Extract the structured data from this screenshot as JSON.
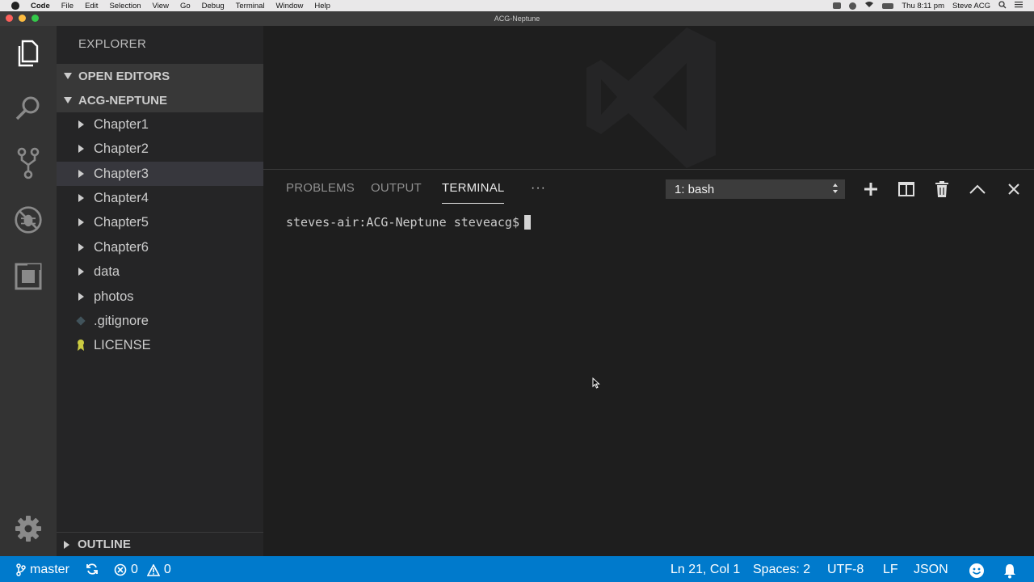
{
  "menubar": {
    "app": "Code",
    "items": [
      "File",
      "Edit",
      "Selection",
      "View",
      "Go",
      "Debug",
      "Terminal",
      "Window",
      "Help"
    ],
    "clock": "Thu 8:11 pm",
    "user": "Steve ACG"
  },
  "window": {
    "title": "ACG-Neptune"
  },
  "activity": [
    "files-icon",
    "search-icon",
    "source-control-icon",
    "debug-icon",
    "extensions-icon",
    "gear-icon"
  ],
  "sidebar": {
    "title": "EXPLORER",
    "open_editors": "OPEN EDITORS",
    "workspace": "ACG-NEPTUNE",
    "items": [
      {
        "label": "Chapter1",
        "kind": "folder"
      },
      {
        "label": "Chapter2",
        "kind": "folder"
      },
      {
        "label": "Chapter3",
        "kind": "folder",
        "selected": true
      },
      {
        "label": "Chapter4",
        "kind": "folder"
      },
      {
        "label": "Chapter5",
        "kind": "folder"
      },
      {
        "label": "Chapter6",
        "kind": "folder"
      },
      {
        "label": "data",
        "kind": "folder"
      },
      {
        "label": "photos",
        "kind": "folder"
      },
      {
        "label": ".gitignore",
        "kind": "file"
      },
      {
        "label": "LICENSE",
        "kind": "file"
      }
    ],
    "outline": "OUTLINE"
  },
  "panel": {
    "tabs": [
      "PROBLEMS",
      "OUTPUT",
      "TERMINAL"
    ],
    "active_tab": "TERMINAL",
    "more": "···",
    "terminal_select": "1: bash",
    "prompt": "steves-air:ACG-Neptune steveacg$"
  },
  "status": {
    "branch": "master",
    "errors": "0",
    "warnings": "0",
    "position": "Ln 21, Col 1",
    "spaces": "Spaces: 2",
    "encoding": "UTF-8",
    "eol": "LF",
    "language": "JSON"
  },
  "colors": {
    "accent": "#007acc",
    "selection": "#37373d"
  }
}
